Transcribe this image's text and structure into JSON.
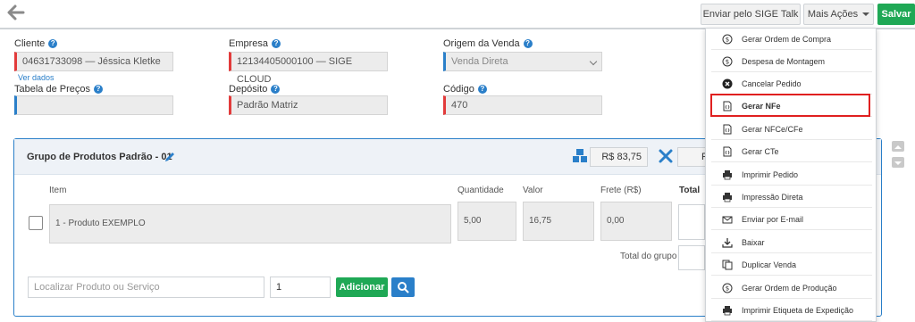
{
  "toolbar": {
    "send_talk": "Enviar pelo SIGE Talk",
    "more_actions": "Mais Ações",
    "save": "Salvar"
  },
  "form": {
    "cliente": {
      "label": "Cliente",
      "value": "04631733098 — Jéssica Kletke",
      "link": "Ver dados"
    },
    "empresa": {
      "label": "Empresa",
      "value": "12134405000100 — SIGE CLOUD"
    },
    "origem": {
      "label": "Origem da Venda",
      "value": "Venda Direta"
    },
    "tabela": {
      "label": "Tabela de Preços",
      "value": ""
    },
    "deposito": {
      "label": "Depósito",
      "value": "Padrão Matriz"
    },
    "codigo": {
      "label": "Código",
      "value": "470"
    }
  },
  "group": {
    "title": "Grupo de Produtos Padrão - 01",
    "total_price": "R$ 83,75",
    "second_box_text": "F",
    "columns": {
      "item": "Item",
      "qty": "Quantidade",
      "value": "Valor",
      "freight": "Frete (R$)",
      "total": "Total"
    },
    "row": {
      "item": "1 - Produto EXEMPLO",
      "qty": "5,00",
      "value": "16,75",
      "freight": "0,00"
    },
    "group_total_label": "Total do grupo",
    "search_placeholder": "Localizar Produto ou Serviço",
    "qty_default": "1",
    "add_label": "Adicionar"
  },
  "menu": {
    "items": [
      {
        "label": "Gerar Ordem de Compra",
        "icon": "dollar-circle-icon"
      },
      {
        "label": "Despesa de Montagem",
        "icon": "dollar-circle-icon"
      },
      {
        "label": "Cancelar Pedido",
        "icon": "cancel-circle-icon"
      },
      {
        "label": "Gerar NFe",
        "icon": "code-file-icon"
      },
      {
        "label": "Gerar NFCe/CFe",
        "icon": "code-file-icon"
      },
      {
        "label": "Gerar CTe",
        "icon": "code-file-icon"
      },
      {
        "label": "Imprimir Pedido",
        "icon": "printer-icon"
      },
      {
        "label": "Impressão Direta",
        "icon": "printer-icon"
      },
      {
        "label": "Enviar por E-mail",
        "icon": "envelope-icon"
      },
      {
        "label": "Baixar",
        "icon": "download-icon"
      },
      {
        "label": "Duplicar Venda",
        "icon": "duplicate-icon"
      },
      {
        "label": "Gerar Ordem de Produção",
        "icon": "dollar-circle-icon"
      },
      {
        "label": "Imprimir Etiqueta de Expedição",
        "icon": "printer-icon"
      }
    ],
    "highlighted": "Gerar NFe"
  },
  "colors": {
    "accent": "#2a7fc9",
    "success": "#1fa855",
    "required": "#e23b3b",
    "highlight": "#e02020"
  }
}
